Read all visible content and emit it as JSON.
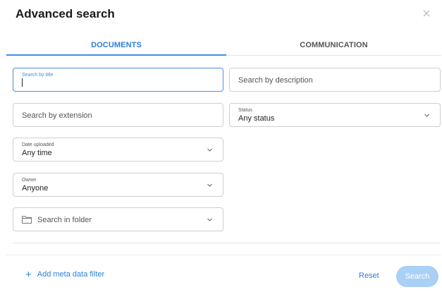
{
  "dialog": {
    "title": "Advanced search",
    "close_icon": "close-icon"
  },
  "tabs": [
    {
      "label": "DOCUMENTS",
      "active": true
    },
    {
      "label": "COMMUNICATION",
      "active": false
    }
  ],
  "fields": {
    "title": {
      "label": "Search by title",
      "value": ""
    },
    "description": {
      "placeholder": "Search by description"
    },
    "extension": {
      "placeholder": "Search by extension"
    },
    "status": {
      "label": "Status",
      "value": "Any status"
    },
    "date_uploaded": {
      "label": "Date uploaded",
      "value": "Any time"
    },
    "owner": {
      "label": "Owner",
      "value": "Anyone"
    },
    "folder": {
      "placeholder": "Search in folder",
      "icon": "folder-icon"
    }
  },
  "footer": {
    "add_filter_label": "Add meta data filter",
    "add_filter_icon": "plus-icon",
    "reset_label": "Reset",
    "search_label": "Search"
  },
  "colors": {
    "accent": "#2f7fd6",
    "search_button": "#a9d0f5"
  }
}
